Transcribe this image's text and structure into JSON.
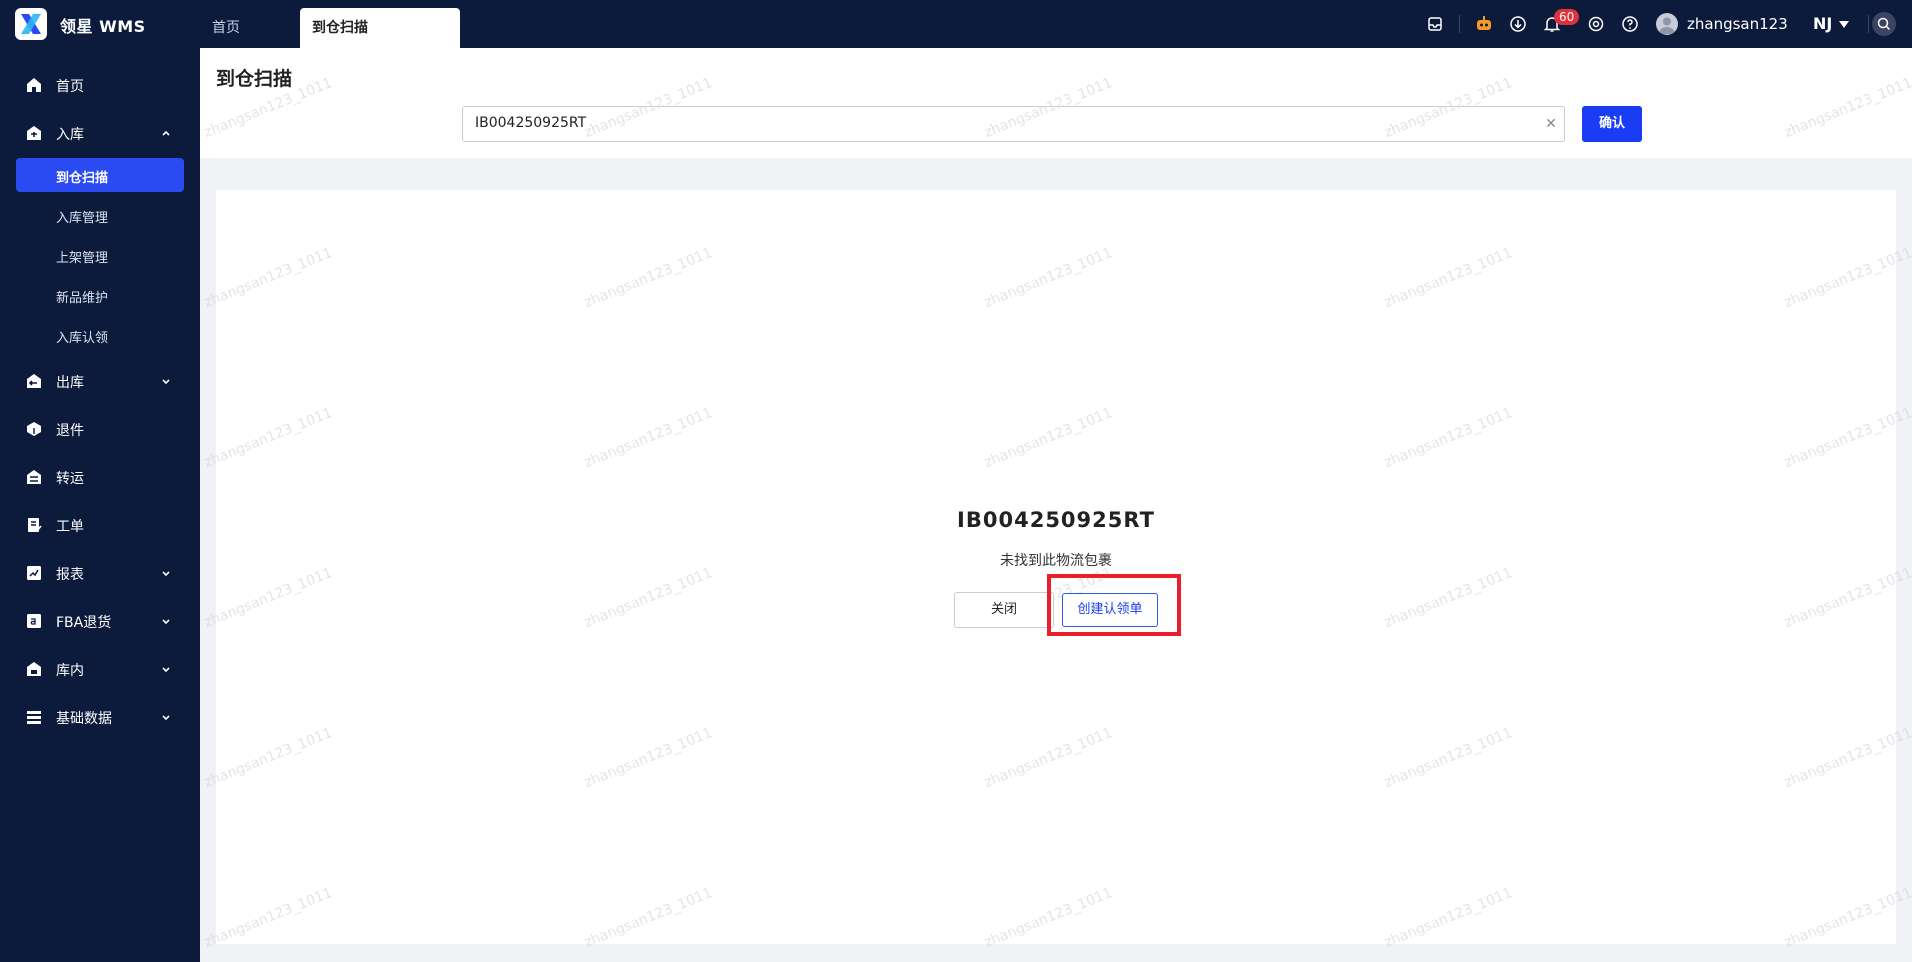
{
  "app": {
    "brand": "领星 WMS"
  },
  "tabs": [
    {
      "label": "首页"
    },
    {
      "label": "到仓扫描"
    }
  ],
  "topbar": {
    "notification_count": "60",
    "username": "zhangsan123",
    "warehouse": "NJ"
  },
  "sidebar": {
    "items": [
      {
        "label": "首页",
        "icon": "home-icon"
      },
      {
        "label": "入库",
        "icon": "inbound-icon"
      },
      {
        "label": "出库",
        "icon": "outbound-icon"
      },
      {
        "label": "退件",
        "icon": "return-icon"
      },
      {
        "label": "转运",
        "icon": "transfer-icon"
      },
      {
        "label": "工单",
        "icon": "workorder-icon"
      },
      {
        "label": "报表",
        "icon": "report-icon"
      },
      {
        "label": "FBA退货",
        "icon": "amazon-icon"
      },
      {
        "label": "库内",
        "icon": "warehouse-icon"
      },
      {
        "label": "基础数据",
        "icon": "data-icon"
      }
    ],
    "inbound_children": [
      {
        "label": "到仓扫描"
      },
      {
        "label": "入库管理"
      },
      {
        "label": "上架管理"
      },
      {
        "label": "新品维护"
      },
      {
        "label": "入库认领"
      }
    ]
  },
  "main": {
    "title": "到仓扫描",
    "scan_value": "IB004250925RT",
    "confirm_label": "确认",
    "result_code": "IB004250925RT",
    "result_message": "未找到此物流包裹",
    "close_label": "关闭",
    "create_label": "创建认领单",
    "watermark": "zhangsan123_1011"
  },
  "colors": {
    "nav_bg": "#0c1a3c",
    "accent": "#1a3cf5",
    "highlight": "#e8202e"
  }
}
